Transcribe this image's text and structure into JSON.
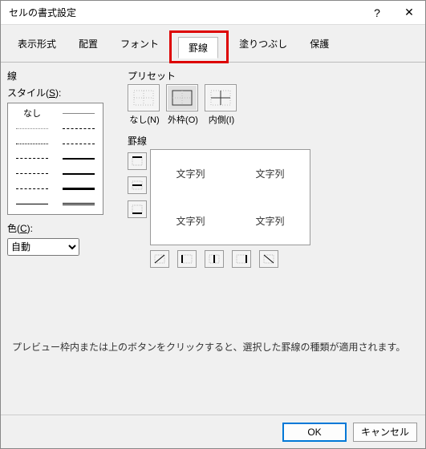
{
  "title": "セルの書式設定",
  "tabs": {
    "display": "表示形式",
    "align": "配置",
    "font": "フォント",
    "border": "罫線",
    "fill": "塗りつぶし",
    "protect": "保護"
  },
  "active_tab": "border",
  "highlighted_tab": "border",
  "line": {
    "group": "線",
    "style_label": "スタイル(S):",
    "style_key": "S",
    "none_label": "なし",
    "color_label": "色(C):",
    "color_key": "C",
    "color_value": "自動"
  },
  "preset": {
    "group": "プリセット",
    "none": "なし(N)",
    "outline": "外枠(O)",
    "inside": "内側(I)"
  },
  "border": {
    "group": "罫線",
    "sample": "文字列"
  },
  "hint": "プレビュー枠内または上のボタンをクリックすると、選択した罫線の種類が適用されます。",
  "buttons": {
    "ok": "OK",
    "cancel": "キャンセル"
  },
  "icons": {
    "help": "?",
    "close": "✕"
  }
}
